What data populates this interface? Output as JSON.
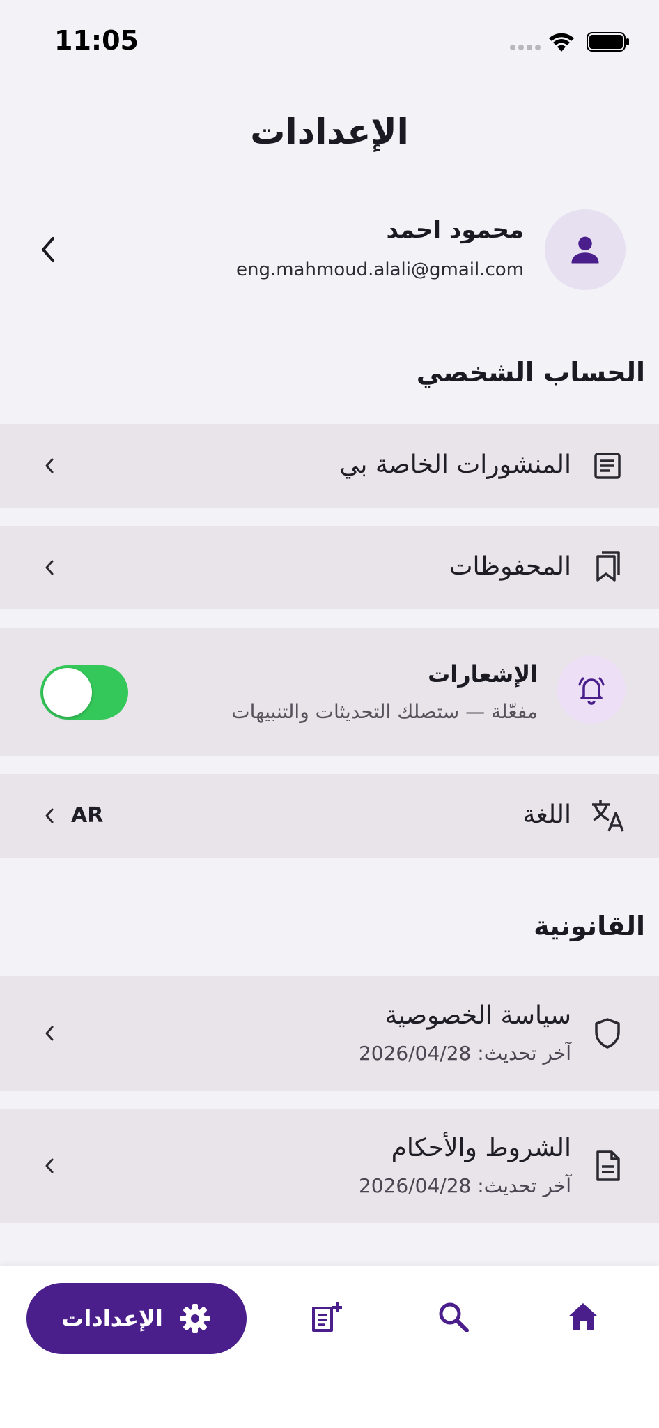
{
  "status_bar": {
    "time": "11:05"
  },
  "header": {
    "title": "الإعدادات"
  },
  "profile": {
    "name": "محمود احمد",
    "email": "eng.mahmoud.alali@gmail.com"
  },
  "sections": {
    "account_title": "الحساب الشخصي",
    "legal_title": "القانونية"
  },
  "rows": {
    "my_posts": {
      "label": "المنشورات الخاصة بي",
      "icon": "document-list-icon"
    },
    "saved": {
      "label": "المحفوظات",
      "icon": "bookmark-icon"
    },
    "notifications": {
      "label": "الإشعارات",
      "subtitle": "مفعّلة — ستصلك التحديثات والتنبيهات",
      "enabled": true,
      "icon": "bell-icon"
    },
    "language": {
      "label": "اللغة",
      "value": "AR",
      "icon": "translate-icon"
    },
    "privacy": {
      "label": "سياسة الخصوصية",
      "subtitle": "آخر تحديث: 2026/04/28",
      "icon": "shield-icon"
    },
    "terms": {
      "label": "الشروط والأحكام",
      "subtitle": "آخر تحديث: 2026/04/28",
      "icon": "file-text-icon"
    }
  },
  "bottom_nav": {
    "settings_label": "الإعدادات",
    "items": [
      "settings-icon",
      "add-post-icon",
      "search-icon",
      "home-icon"
    ]
  },
  "colors": {
    "primary": "#4a1f8c",
    "row_background": "#e9e4ea",
    "page_background": "#f3f2f7",
    "toggle_on": "#34c759"
  }
}
